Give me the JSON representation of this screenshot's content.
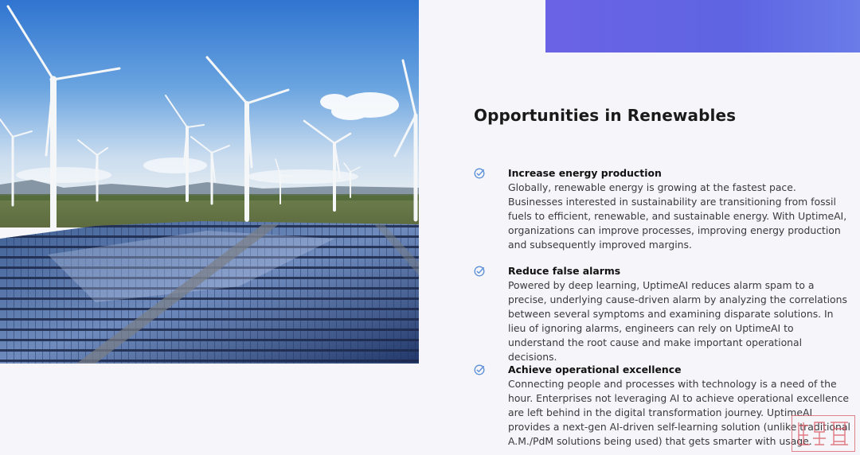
{
  "colors": {
    "accent": "#6b63e6",
    "check": "#5b8fd6",
    "background": "#f5f5fa",
    "watermark": "#dc5a64"
  },
  "hero": {
    "icon": "wind-turbines-and-solar-panels-photo"
  },
  "section": {
    "title": "Opportunities in Renewables"
  },
  "features": [
    {
      "icon": "check-circle-icon",
      "heading": "Increase energy production",
      "body": "Globally, renewable energy is growing at the fastest pace. Businesses interested in sustainability are transitioning from fossil fuels to efficient, renewable, and sustainable energy. With UptimeAI, organizations can improve processes, improving energy production and subsequently improved margins."
    },
    {
      "icon": "check-circle-icon",
      "heading": "Reduce false alarms",
      "body": "Powered by deep learning, UptimeAI reduces alarm spam to a precise, underlying cause-driven alarm by analyzing the correlations between several symptoms and examining disparate solutions. In lieu of ignoring alarms, engineers can rely on UptimeAI to understand the root cause and make important operational decisions."
    },
    {
      "icon": "check-circle-icon",
      "heading": "Achieve operational excellence",
      "body": "Connecting people and processes with technology is a need of the hour. Enterprises not leveraging AI to achieve operational excellence are left behind in the digital transformation journey. UptimeAI provides a next-gen AI-driven self-learning solution (unlike traditional A.M./PdM solutions being used) that gets smarter with usage."
    }
  ]
}
